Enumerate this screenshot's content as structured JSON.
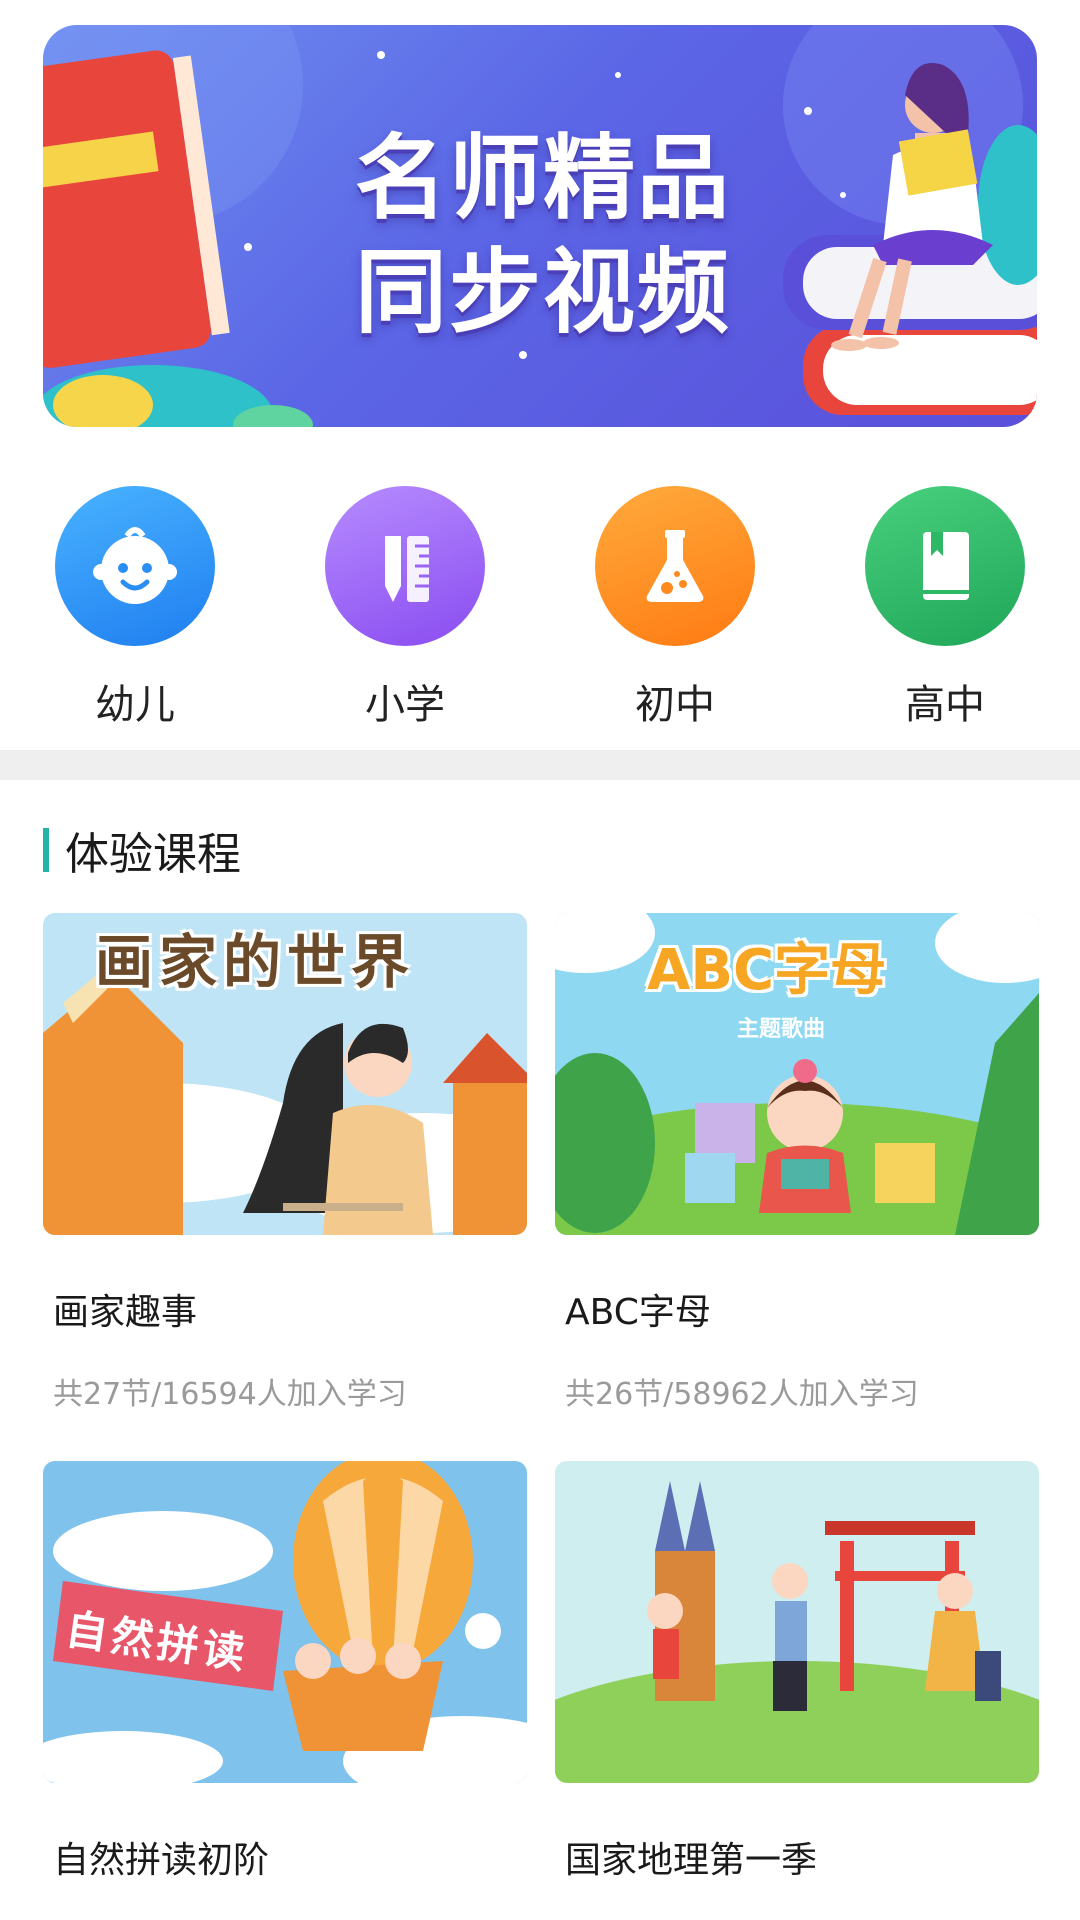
{
  "banner": {
    "line1": "名师精品",
    "line2": "同步视频"
  },
  "categories": [
    {
      "label": "幼儿",
      "icon": "baby-face-icon"
    },
    {
      "label": "小学",
      "icon": "pencil-ruler-icon"
    },
    {
      "label": "初中",
      "icon": "flask-icon"
    },
    {
      "label": "高中",
      "icon": "book-icon"
    }
  ],
  "section": {
    "title": "体验课程",
    "accent": "#23b3a8"
  },
  "courses": [
    {
      "thumb_text": "画家的世界",
      "name": "画家趣事",
      "meta": "共27节/16594人加入学习"
    },
    {
      "thumb_text": "ABC字母",
      "thumb_sub": "主题歌曲",
      "name": "ABC字母",
      "meta": "共26节/58962人加入学习"
    },
    {
      "thumb_text": "自然拼读",
      "name": "自然拼读初阶",
      "meta": ""
    },
    {
      "thumb_text": "",
      "name": "国家地理第一季",
      "meta": ""
    }
  ]
}
